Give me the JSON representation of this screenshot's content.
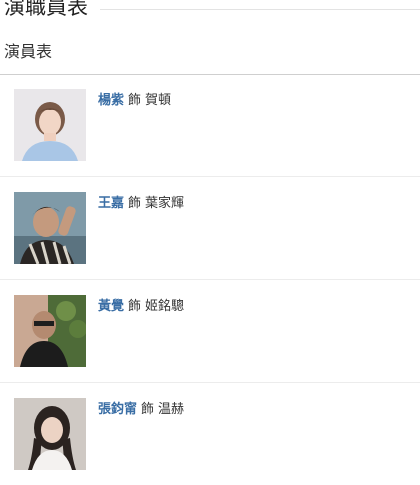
{
  "section": {
    "title": "演職員表"
  },
  "subsection": {
    "title": "演員表"
  },
  "cast": [
    {
      "actor": "楊紫",
      "as": "飾",
      "character": "賀頓"
    },
    {
      "actor": "王嘉",
      "as": "飾",
      "character": "葉家輝"
    },
    {
      "actor": "黃覺",
      "as": "飾",
      "character": "姬銘驄"
    },
    {
      "actor": "張鈞甯",
      "as": "飾",
      "character": "温赫"
    }
  ]
}
